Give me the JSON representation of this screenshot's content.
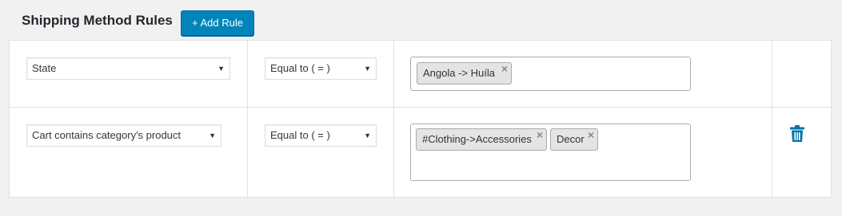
{
  "header": {
    "title": "Shipping Method Rules",
    "add_button_label": "+ Add Rule"
  },
  "rules": [
    {
      "field": "State",
      "operator": "Equal to ( = )",
      "values": [
        "Angola -> Huíla"
      ]
    },
    {
      "field": "Cart contains category's product",
      "operator": "Equal to ( = )",
      "values": [
        "#Clothing->Accessories",
        "Decor"
      ]
    }
  ],
  "icons": {
    "select_arrow": "▼",
    "remove_chip": "×",
    "delete_rule": "trash-icon"
  },
  "colors": {
    "primary_button": "#0085ba",
    "trash_icon": "#0073aa",
    "background": "#f1f1f1"
  }
}
